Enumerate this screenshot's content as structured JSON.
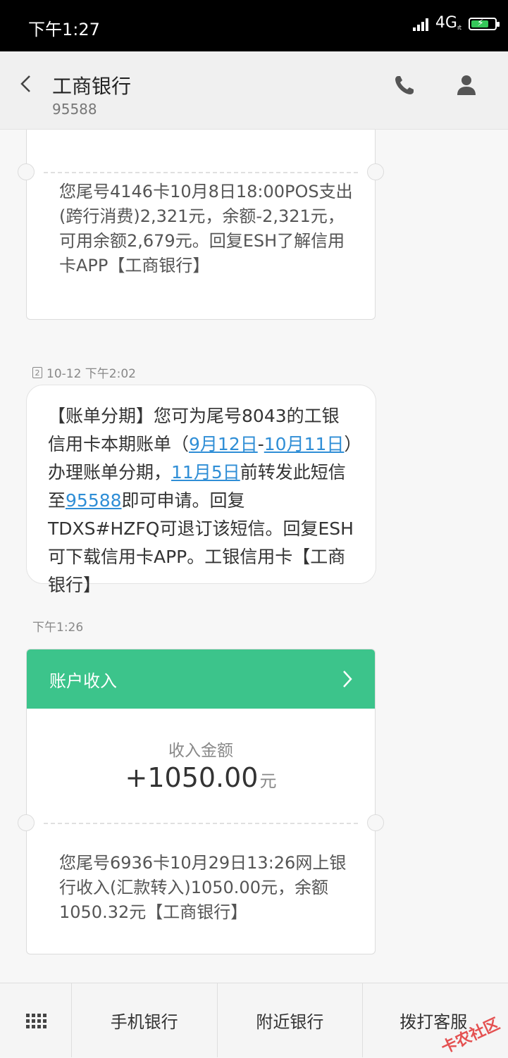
{
  "status_bar": {
    "time": "下午1:27",
    "network": "4G",
    "network_sub": "ıt"
  },
  "header": {
    "title": "工商银行",
    "number": "95588"
  },
  "messages": {
    "msg1": {
      "text": "您尾号4146卡10月8日18:00POS支出(跨行消费)2,321元，余额-2,321元，可用余额2,679元。回复ESH了解信用卡APP【工商银行】"
    },
    "msg2": {
      "sim": "2",
      "timestamp": "10-12 下午2:02",
      "part1": "【账单分期】您可为尾号8043的工银信用卡本期账单（",
      "link1": "9月12日",
      "dash": "-",
      "link2": "10月11日",
      "part2": "）办理账单分期，",
      "link3": "11月5日",
      "part3": "前转发此短信至",
      "link4": "95588",
      "part4": "即可申请。回复TDXS#HZFQ可退订该短信。回复ESH可下载信用卡APP。工银信用卡【工商银行】"
    },
    "msg3": {
      "timestamp": "下午1:26",
      "card_title": "账户收入",
      "amount_label": "收入金额",
      "amount": "+1050.00",
      "unit": "元",
      "text": "您尾号6936卡10月29日13:26网上银行收入(汇款转入)1050.00元，余额1050.32元【工商银行】"
    }
  },
  "bottom_bar": {
    "btn1": "手机银行",
    "btn2": "附近银行",
    "btn3": "拨打客服"
  },
  "watermark": "卡农社区"
}
